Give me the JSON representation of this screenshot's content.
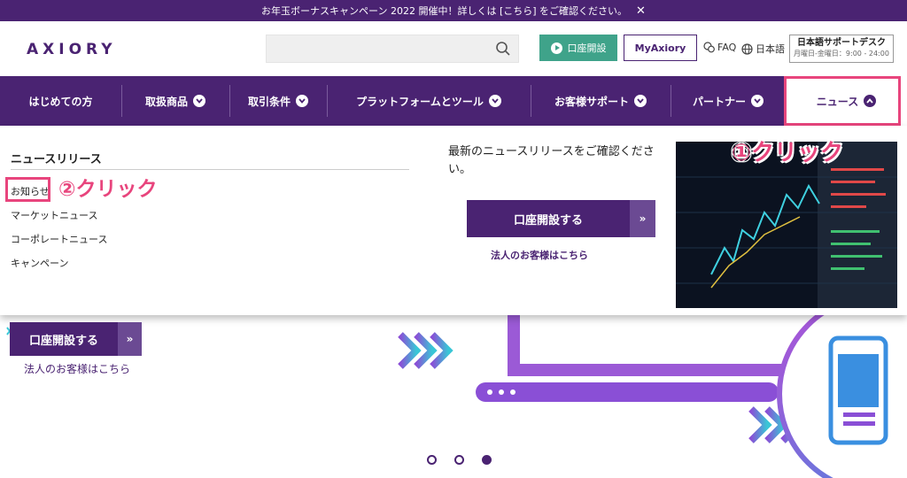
{
  "banner": {
    "text": "お年玉ボーナスキャンペーン 2022 開催中！詳しくは [こちら] をご確認ください。",
    "close_glyph": "✕"
  },
  "header": {
    "logo": "AXIORY",
    "search_placeholder": "",
    "open_account_label": "口座開設",
    "myaxiory_label": "MyAxiory",
    "faq_label": "FAQ",
    "lang_label": "日本語",
    "support_title": "日本語サポートデスク",
    "support_hours": "月曜日-金曜日：9:00 - 24:00"
  },
  "nav": {
    "items": [
      {
        "label": "はじめての方"
      },
      {
        "label": "取扱商品"
      },
      {
        "label": "取引条件"
      },
      {
        "label": "プラットフォームとツール"
      },
      {
        "label": "お客様サポート"
      },
      {
        "label": "パートナー"
      },
      {
        "label": "ニュース"
      }
    ]
  },
  "dropdown": {
    "section_title": "ニュースリリース",
    "links": [
      "お知らせ",
      "マーケットニュース",
      "コーポレートニュース",
      "キャンペーン"
    ],
    "description": "最新のニュースリリースをご確認ください。",
    "cta_label": "口座開設する",
    "cta_arrow": "»",
    "corporate_link": "法人のお客様はこちら"
  },
  "annotations": {
    "callout_1": "①クリック",
    "callout_2": "②クリック",
    "highlight_color": "#e8457d"
  },
  "hero": {
    "cta_label": "口座開設する",
    "cta_arrow": "»",
    "corporate_link": "法人のお客様はこちら"
  },
  "carousel": {
    "current": 3,
    "total": 3
  },
  "colors": {
    "brand": "#4a2372",
    "green": "#3fa38a"
  }
}
